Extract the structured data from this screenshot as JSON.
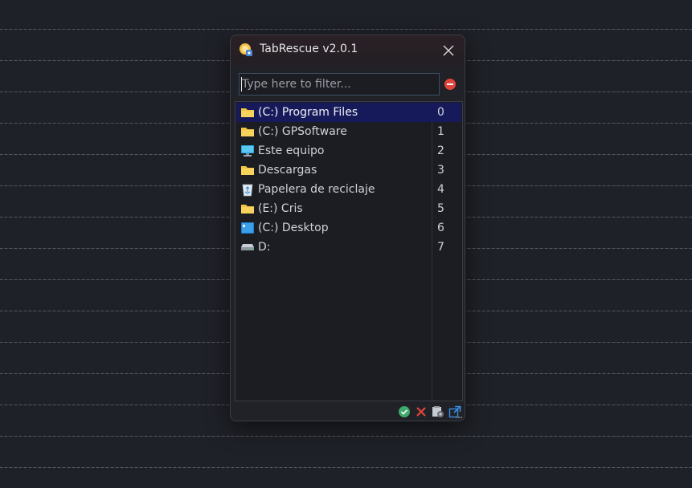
{
  "window": {
    "title": "TabRescue v2.0.1",
    "close_label": "✕"
  },
  "filter": {
    "placeholder": "Type here to filter...",
    "value": ""
  },
  "list": {
    "selected_index": 0,
    "items": [
      {
        "label": "(C:) Program Files",
        "index": "0",
        "icon": "folder-icon"
      },
      {
        "label": "(C:) GPSoftware",
        "index": "1",
        "icon": "folder-icon"
      },
      {
        "label": "Este equipo",
        "index": "2",
        "icon": "computer-icon"
      },
      {
        "label": "Descargas",
        "index": "3",
        "icon": "folder-icon"
      },
      {
        "label": "Papelera de reciclaje",
        "index": "4",
        "icon": "recycle-bin-icon"
      },
      {
        "label": "(E:) Cris",
        "index": "5",
        "icon": "folder-icon"
      },
      {
        "label": "(C:) Desktop",
        "index": "6",
        "icon": "desktop-icon"
      },
      {
        "label": "D:",
        "index": "7",
        "icon": "drive-icon"
      }
    ]
  },
  "footer": {
    "icons": [
      "confirm-icon",
      "cancel-icon",
      "settings-icon",
      "external-link-icon"
    ]
  },
  "colors": {
    "background": "#1f2128",
    "window": "#202227",
    "selection": "#171a5a",
    "folder": "#f4c542",
    "accent_red": "#e0443a",
    "accent_green": "#3fa86b",
    "accent_blue": "#3a8ee6"
  }
}
